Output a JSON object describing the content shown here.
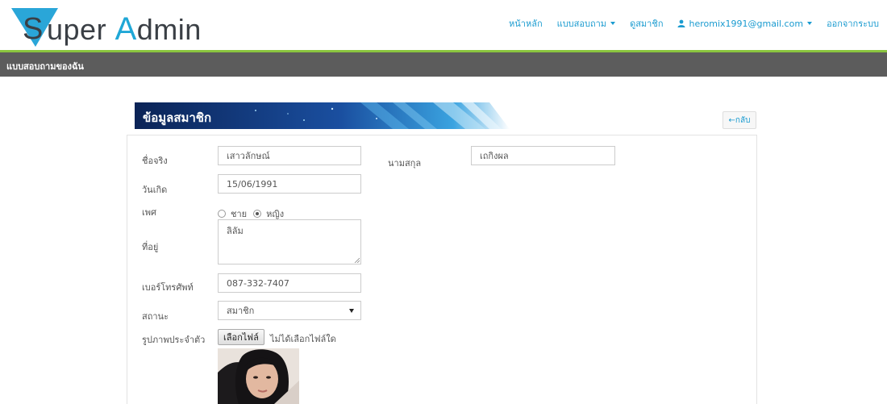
{
  "header": {
    "logo": {
      "s": "S",
      "rest_a": "uper ",
      "cap": "A",
      "rest_b": "dmin"
    },
    "nav": {
      "home": "หน้าหลัก",
      "survey": "แบบสอบถาม",
      "members": "ดูสมาชิก",
      "user_email": "heromix1991@gmail.com",
      "logout": "ออกจากระบบ"
    }
  },
  "subbar": {
    "title": "แบบสอบถามของฉัน"
  },
  "panel": {
    "heading": "ข้อมูลสมาชิก",
    "back_label": "←กลับ"
  },
  "form": {
    "first_name": {
      "label": "ชื่อจริง",
      "value": "เสาวลักษณ์"
    },
    "last_name": {
      "label": "นามสกุล",
      "value": "เถกิงผล"
    },
    "birthday": {
      "label": "วันเกิด",
      "value": "15/06/1991"
    },
    "gender": {
      "label": "เพศ",
      "male": "ชาย",
      "female": "หญิง",
      "selected": "female"
    },
    "address": {
      "label": "ที่อยู่",
      "value": "ลิลัม"
    },
    "phone": {
      "label": "เบอร์โทรศัพท์",
      "value": "087-332-7407"
    },
    "status": {
      "label": "สถานะ",
      "value": "สมาชิก"
    },
    "photo": {
      "label": "รูปภาพประจำตัว",
      "button": "เลือกไฟล์",
      "status": "ไม่ได้เลือกไฟล์ใด"
    }
  },
  "colors": {
    "accent": "#1a9bd0",
    "green_line": "#8bc53f",
    "subbar": "#5c5c5c",
    "banner": "#0a2a5c"
  },
  "icons": {
    "user": "user-icon",
    "caret": "caret-down-icon",
    "logo_triangle": "logo-triangle-icon",
    "select_arrow": "select-arrow-icon"
  }
}
